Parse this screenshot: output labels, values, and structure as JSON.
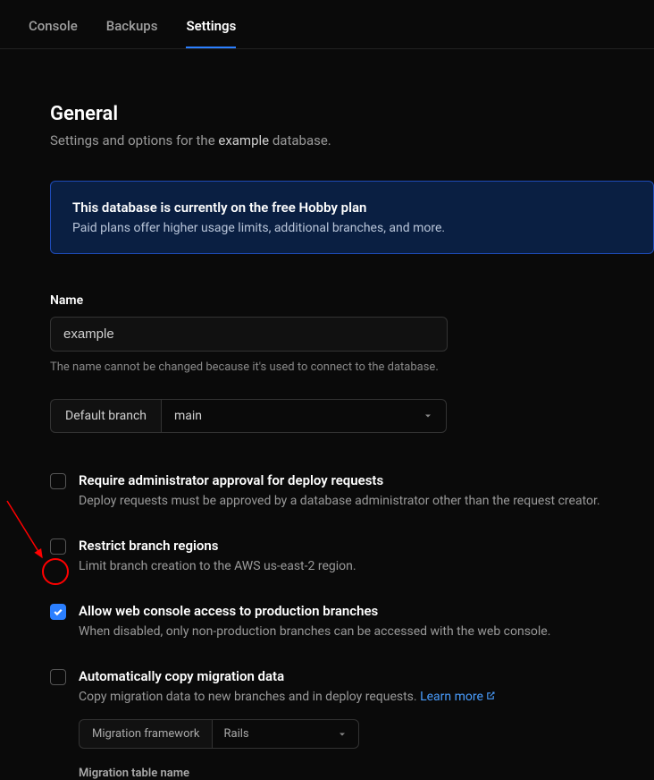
{
  "tabs": {
    "console": "Console",
    "backups": "Backups",
    "settings": "Settings"
  },
  "section": {
    "title": "General",
    "subtitle_prefix": "Settings and options for the ",
    "subtitle_db": "example",
    "subtitle_suffix": " database."
  },
  "banner": {
    "title": "This database is currently on the free Hobby plan",
    "text": "Paid plans offer higher usage limits, additional branches, and more."
  },
  "name_field": {
    "label": "Name",
    "value": "example",
    "help": "The name cannot be changed because it's used to connect to the database."
  },
  "branch": {
    "label": "Default branch",
    "value": "main"
  },
  "checkboxes": {
    "admin_approval": {
      "title": "Require administrator approval for deploy requests",
      "desc": "Deploy requests must be approved by a database administrator other than the request creator."
    },
    "restrict_regions": {
      "title": "Restrict branch regions",
      "desc": "Limit branch creation to the AWS us-east-2 region."
    },
    "web_console": {
      "title": "Allow web console access to production branches",
      "desc": "When disabled, only non-production branches can be accessed with the web console."
    },
    "migration": {
      "title": "Automatically copy migration data",
      "desc": "Copy migration data to new branches and in deploy requests. ",
      "learn_more": "Learn more"
    }
  },
  "migration_framework": {
    "label": "Migration framework",
    "value": "Rails"
  },
  "migration_table": {
    "label": "Migration table name"
  }
}
